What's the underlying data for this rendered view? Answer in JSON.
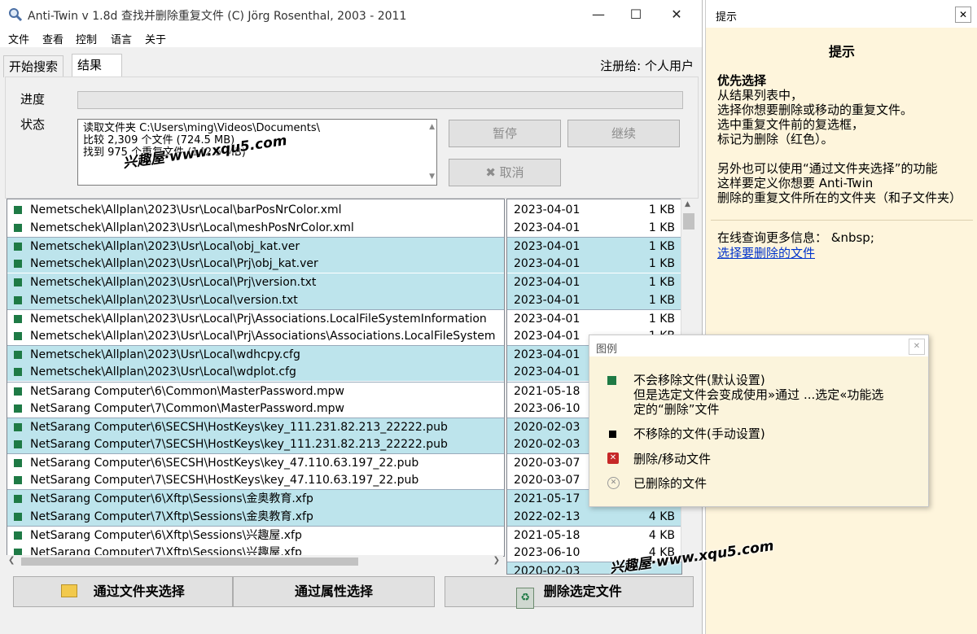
{
  "window": {
    "title": "Anti-Twin    v 1.8d    查找并删除重复文件    (C) Jörg Rosenthal, 2003 - 2011"
  },
  "menu": [
    "文件",
    "查看",
    "控制",
    "语言",
    "关于"
  ],
  "tabs": [
    {
      "label": "开始搜索"
    },
    {
      "label": "结果"
    }
  ],
  "registered": "注册给: 个人用户",
  "panel": {
    "progress_label": "进度",
    "status_label": "状态",
    "status_lines": [
      "读取文件夹 C:\\Users\\ming\\Videos\\Documents\\",
      "比较 2,309 个文件 (724.5 MB)",
      "找到 975 个重复文件 (142.5 MB)"
    ],
    "pause_label": "暂停",
    "continue_label": "继续",
    "cancel_label": "取消"
  },
  "files": [
    {
      "path": "Nemetschek\\Allplan\\2023\\Usr\\Local\\barPosNrColor.xml",
      "date": "2023-04-01",
      "size": "1 KB",
      "hl": false,
      "sep": false
    },
    {
      "path": "Nemetschek\\Allplan\\2023\\Usr\\Local\\meshPosNrColor.xml",
      "date": "2023-04-01",
      "size": "1 KB",
      "hl": false,
      "sep": false
    },
    {
      "path": "Nemetschek\\Allplan\\2023\\Usr\\Local\\obj_kat.ver",
      "date": "2023-04-01",
      "size": "1 KB",
      "hl": true,
      "sep": true
    },
    {
      "path": "Nemetschek\\Allplan\\2023\\Usr\\Local\\Prj\\obj_kat.ver",
      "date": "2023-04-01",
      "size": "1 KB",
      "hl": true,
      "sep": false
    },
    {
      "path": "Nemetschek\\Allplan\\2023\\Usr\\Local\\Prj\\version.txt",
      "date": "2023-04-01",
      "size": "1 KB",
      "hl": true,
      "sep": false
    },
    {
      "path": "Nemetschek\\Allplan\\2023\\Usr\\Local\\version.txt",
      "date": "2023-04-01",
      "size": "1 KB",
      "hl": true,
      "sep": false
    },
    {
      "path": "Nemetschek\\Allplan\\2023\\Usr\\Local\\Prj\\Associations.LocalFileSystemInformation",
      "date": "2023-04-01",
      "size": "1 KB",
      "hl": false,
      "sep": true
    },
    {
      "path": "Nemetschek\\Allplan\\2023\\Usr\\Local\\Prj\\Associations\\Associations.LocalFileSystem",
      "date": "2023-04-01",
      "size": "1 KB",
      "hl": false,
      "sep": false
    },
    {
      "path": "Nemetschek\\Allplan\\2023\\Usr\\Local\\wdhcpy.cfg",
      "date": "2023-04-01",
      "size": "",
      "hl": true,
      "sep": true
    },
    {
      "path": "Nemetschek\\Allplan\\2023\\Usr\\Local\\wdplot.cfg",
      "date": "2023-04-01",
      "size": "",
      "hl": true,
      "sep": false
    },
    {
      "path": "NetSarang Computer\\6\\Common\\MasterPassword.mpw",
      "date": "2021-05-18",
      "size": "",
      "hl": false,
      "sep": true
    },
    {
      "path": "NetSarang Computer\\7\\Common\\MasterPassword.mpw",
      "date": "2023-06-10",
      "size": "",
      "hl": false,
      "sep": false
    },
    {
      "path": "NetSarang Computer\\6\\SECSH\\HostKeys\\key_111.231.82.213_22222.pub",
      "date": "2020-02-03",
      "size": "",
      "hl": true,
      "sep": true
    },
    {
      "path": "NetSarang Computer\\7\\SECSH\\HostKeys\\key_111.231.82.213_22222.pub",
      "date": "2020-02-03",
      "size": "",
      "hl": true,
      "sep": false
    },
    {
      "path": "NetSarang Computer\\6\\SECSH\\HostKeys\\key_47.110.63.197_22.pub",
      "date": "2020-03-07",
      "size": "",
      "hl": false,
      "sep": true
    },
    {
      "path": "NetSarang Computer\\7\\SECSH\\HostKeys\\key_47.110.63.197_22.pub",
      "date": "2020-03-07",
      "size": "",
      "hl": false,
      "sep": false
    },
    {
      "path": "NetSarang Computer\\6\\Xftp\\Sessions\\金奥教育.xfp",
      "date": "2021-05-17",
      "size": "",
      "hl": true,
      "sep": true
    },
    {
      "path": "NetSarang Computer\\7\\Xftp\\Sessions\\金奥教育.xfp",
      "date": "2022-02-13",
      "size": "4 KB",
      "hl": true,
      "sep": false
    },
    {
      "path": "NetSarang Computer\\6\\Xftp\\Sessions\\兴趣屋.xfp",
      "date": "2021-05-18",
      "size": "4 KB",
      "hl": false,
      "sep": true
    },
    {
      "path": "NetSarang Computer\\7\\Xftp\\Sessions\\兴趣屋.xfp",
      "date": "2023-06-10",
      "size": "4 KB",
      "hl": false,
      "sep": false
    },
    {
      "path": "",
      "date": "2020-02-03",
      "size": "",
      "hl": true,
      "sep": true
    }
  ],
  "buttons": {
    "by_folder": "通过文件夹选择",
    "by_attr": "通过属性选择",
    "delete": "删除选定文件"
  },
  "hint": {
    "bar_title": "提示",
    "title": "提示",
    "heading": "优先选择",
    "lines": [
      "从结果列表中，",
      "选择你想要删除或移动的重复文件。",
      "选中重复文件前的复选框，",
      "标记为删除（红色）。",
      "",
      "另外也可以使用“通过文件夹选择”的功能",
      "这样要定义你想要 Anti-Twin",
      "删除的重复文件所在的文件夹（和子文件夹）"
    ],
    "more_info": "在线查询更多信息： &nbsp;",
    "link": "选择要删除的文件"
  },
  "legend": {
    "title": "图例",
    "items": [
      {
        "icon": "green-square-icon",
        "lines": [
          "不会移除文件(默认设置)",
          "但是选定文件会变成使用»通过 ...选定«功能选",
          "定的“删除”文件"
        ]
      },
      {
        "icon": "black-square-icon",
        "lines": [
          "不移除的文件(手动设置)"
        ]
      },
      {
        "icon": "red-x-icon",
        "lines": [
          "删除/移动文件"
        ]
      },
      {
        "icon": "gray-x-icon",
        "lines": [
          "已删除的文件"
        ]
      }
    ]
  },
  "watermark": "兴趣屋·www.xqu5.com",
  "colors": {
    "highlight": "#bde4ec",
    "green": "#1e7a45",
    "hint_bg": "#fef5dc",
    "legend_bg": "#fbf4dc"
  }
}
